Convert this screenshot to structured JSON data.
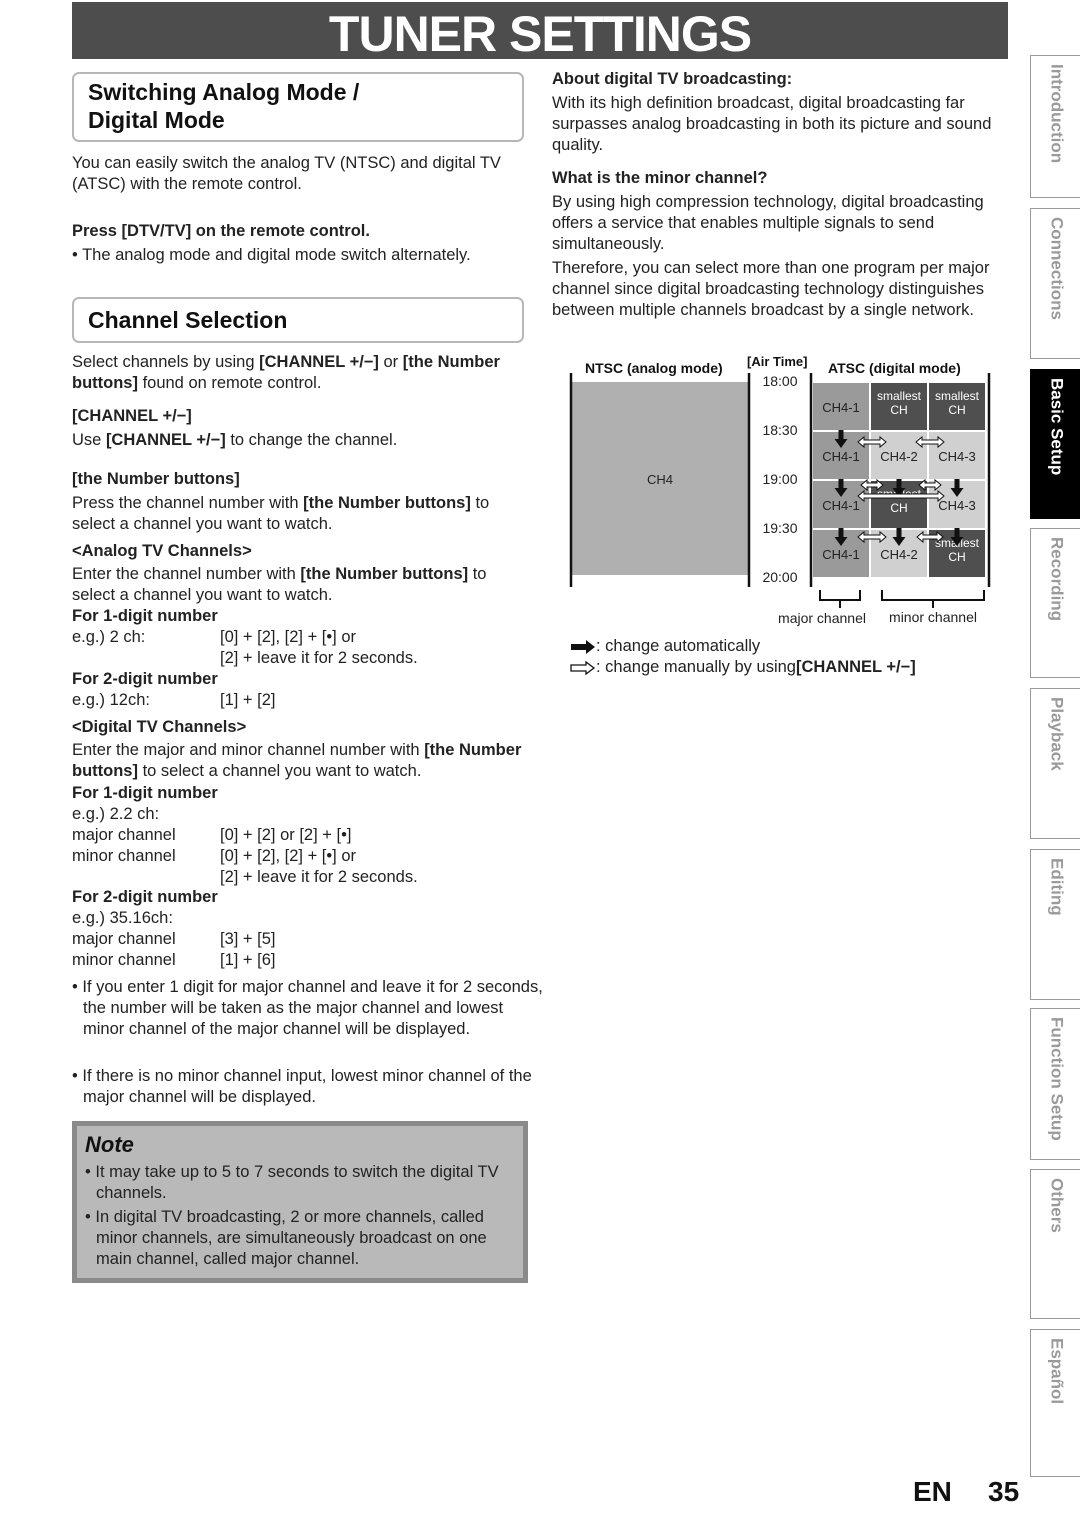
{
  "page_title": "TUNER SETTINGS",
  "section1": {
    "heading_line1": "Switching Analog Mode /",
    "heading_line2": "Digital Mode",
    "intro": "You can easily switch the analog TV (NTSC) and digital TV (ATSC) with the remote control.",
    "step": "Press [DTV/TV] on the remote control.",
    "bullet": "• The analog mode and digital mode switch alternately."
  },
  "section2": {
    "heading": "Channel Selection",
    "intro_a": "Select channels by using ",
    "intro_b": "[CHANNEL +/−]",
    "intro_c": " or ",
    "intro_d": "[the Number buttons]",
    "intro_e": " found on remote control.",
    "ch_heading": "[CHANNEL +/−]",
    "ch_text_a": "Use ",
    "ch_text_b": "[CHANNEL +/−]",
    "ch_text_c": " to change the channel.",
    "num_heading": "[the Number buttons]",
    "num_text_a": "Press the channel number with ",
    "num_text_b": "[the Number buttons]",
    "num_text_c": " to select a channel you want to watch.",
    "analog": {
      "heading": "<Analog TV Channels>",
      "text_a": "Enter the channel number with ",
      "text_b": "[the Number buttons]",
      "text_c": " to select a channel you want to watch.",
      "one_digit_heading": "For 1-digit number",
      "one_digit_rows": [
        {
          "k": "e.g.) 2 ch:",
          "v": "[0] + [2], [2] + [•] or"
        },
        {
          "k": "",
          "v": "[2] + leave it for 2 seconds."
        }
      ],
      "two_digit_heading": "For 2-digit number",
      "two_digit_rows": [
        {
          "k": "e.g.) 12ch:",
          "v": "[1] + [2]"
        }
      ]
    },
    "digital": {
      "heading": "<Digital TV Channels>",
      "text_a": "Enter the major and minor channel number with ",
      "text_b": "[the Number buttons]",
      "text_c": " to select a channel you want to watch.",
      "one_digit_heading": "For 1-digit number",
      "one_digit_example": "e.g.) 2.2 ch:",
      "one_digit_rows": [
        {
          "k": "major channel",
          "v": "[0] + [2] or [2] + [•]"
        },
        {
          "k": "minor channel",
          "v": "[0] + [2], [2] + [•] or"
        },
        {
          "k": "",
          "v": "[2] + leave it for 2 seconds."
        }
      ],
      "two_digit_heading": "For 2-digit number",
      "two_digit_example": "e.g.) 35.16ch:",
      "two_digit_rows": [
        {
          "k": "major channel",
          "v": "[3] + [5]"
        },
        {
          "k": "minor channel",
          "v": "[1] + [6]"
        }
      ]
    },
    "bullets": [
      "• If you enter 1 digit for major channel and leave it for 2 seconds, the number will be taken as the major channel and lowest minor channel of the major channel will be displayed.",
      "• If there is no minor channel input, lowest minor channel of the major channel will be displayed."
    ]
  },
  "note": {
    "heading": "Note",
    "items": [
      "• It may take up to 5 to 7 seconds to switch the digital TV channels.",
      "• In digital TV broadcasting, 2 or more channels, called minor channels, are simultaneously broadcast on one main channel, called major channel."
    ]
  },
  "right": {
    "about_heading": "About digital TV broadcasting:",
    "about_text": "With its high definition broadcast, digital broadcasting far surpasses analog broadcasting in both its picture and sound quality.",
    "minor_heading": "What is the minor channel?",
    "minor_text1": "By using high compression technology, digital broadcasting offers a service that enables multiple signals to send simultaneously.",
    "minor_text2": "Therefore, you can select more than one program per major channel since digital broadcasting technology distinguishes between multiple channels broadcast by a single network."
  },
  "diagram": {
    "ntsc_label": "NTSC (analog mode)",
    "airtime_label": "[Air Time]",
    "atsc_label": "ATSC (digital mode)",
    "ntsc_channel": "CH4",
    "times": [
      "18:00",
      "18:30",
      "19:00",
      "19:30",
      "20:00"
    ],
    "grid": [
      [
        {
          "t": "CH4-1",
          "s": "mid"
        },
        {
          "t": "smallest CH",
          "s": "dark"
        },
        {
          "t": "smallest CH",
          "s": "dark"
        }
      ],
      [
        {
          "t": "CH4-1",
          "s": "mid"
        },
        {
          "t": "CH4-2",
          "s": "light"
        },
        {
          "t": "CH4-3",
          "s": "light"
        }
      ],
      [
        {
          "t": "CH4-1",
          "s": "mid"
        },
        {
          "t": "smallest CH",
          "s": "dark"
        },
        {
          "t": "CH4-3",
          "s": "light"
        }
      ],
      [
        {
          "t": "CH4-1",
          "s": "mid"
        },
        {
          "t": "CH4-2",
          "s": "light"
        },
        {
          "t": "smallest CH",
          "s": "dark"
        }
      ]
    ],
    "major_label": "major channel",
    "minor_label": "minor channel",
    "legend_auto": ": change automatically",
    "legend_manual_a": ": change manually by using ",
    "legend_manual_b": "[CHANNEL +/−]",
    "colors": {
      "mid": "#9a9a9a",
      "light": "#d0d0d0",
      "dark": "#4f4f4f",
      "ntsc": "#b0b0b0"
    }
  },
  "side_tabs": [
    {
      "label": "Introduction",
      "active": false
    },
    {
      "label": "Connections",
      "active": false
    },
    {
      "label": "Basic Setup",
      "active": true
    },
    {
      "label": "Recording",
      "active": false
    },
    {
      "label": "Playback",
      "active": false
    },
    {
      "label": "Editing",
      "active": false
    },
    {
      "label": "Function Setup",
      "active": false
    },
    {
      "label": "Others",
      "active": false
    },
    {
      "label": "Español",
      "active": false
    }
  ],
  "footer": {
    "lang": "EN",
    "page": "35"
  }
}
